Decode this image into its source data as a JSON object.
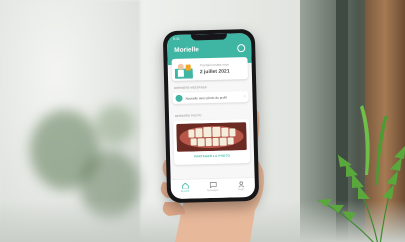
{
  "app": {
    "title": "Morielle",
    "status_time": "9:41",
    "appointment": {
      "label": "Prochain rendez-vous",
      "date": "2 juillet 2021"
    },
    "messages_section": "DERNIERS MESSAGES",
    "message_text": "Nouvelle avec photo du profil",
    "photo_section": "DERNIÈRE PHOTO",
    "share_label": "PARTAGER LA PHOTO",
    "tabs": [
      {
        "label": "Accueil"
      },
      {
        "label": "Messages"
      },
      {
        "label": "Profil"
      }
    ],
    "accent_color": "#3fb5a3"
  }
}
